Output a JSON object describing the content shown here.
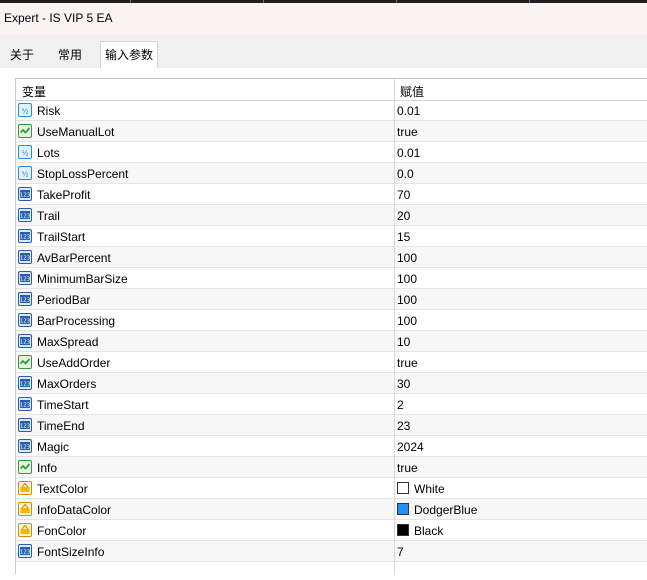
{
  "window": {
    "title": "Expert - IS VIP 5 EA"
  },
  "tabs": [
    {
      "label": "关于",
      "active": false
    },
    {
      "label": "常用",
      "active": false
    },
    {
      "label": "输入参数",
      "active": true
    }
  ],
  "table": {
    "headers": {
      "variable": "变量",
      "value": "赋值"
    },
    "rows": [
      {
        "name": "Risk",
        "value": "0.01",
        "type": "double"
      },
      {
        "name": "UseManualLot",
        "value": "true",
        "type": "bool"
      },
      {
        "name": "Lots",
        "value": "0.01",
        "type": "double"
      },
      {
        "name": "StopLossPercent",
        "value": "0.0",
        "type": "double"
      },
      {
        "name": "TakeProfit",
        "value": "70",
        "type": "int"
      },
      {
        "name": "Trail",
        "value": "20",
        "type": "int"
      },
      {
        "name": "TrailStart",
        "value": "15",
        "type": "int"
      },
      {
        "name": "AvBarPercent",
        "value": "100",
        "type": "int"
      },
      {
        "name": "MinimumBarSize",
        "value": "100",
        "type": "int"
      },
      {
        "name": "PeriodBar",
        "value": "100",
        "type": "int"
      },
      {
        "name": "BarProcessing",
        "value": "100",
        "type": "int"
      },
      {
        "name": "MaxSpread",
        "value": "10",
        "type": "int"
      },
      {
        "name": "UseAddOrder",
        "value": "true",
        "type": "bool"
      },
      {
        "name": "MaxOrders",
        "value": "30",
        "type": "int"
      },
      {
        "name": "TimeStart",
        "value": "2",
        "type": "int"
      },
      {
        "name": "TimeEnd",
        "value": "23",
        "type": "int"
      },
      {
        "name": "Magic",
        "value": "2024",
        "type": "int"
      },
      {
        "name": "Info",
        "value": "true",
        "type": "bool"
      },
      {
        "name": "TextColor",
        "value": "White",
        "type": "color",
        "swatch": "#ffffff"
      },
      {
        "name": "InfoDataColor",
        "value": "DodgerBlue",
        "type": "color",
        "swatch": "#1e90ff"
      },
      {
        "name": "FonColor",
        "value": "Black",
        "type": "color",
        "swatch": "#000000"
      },
      {
        "name": "FontSizeInfo",
        "value": "7",
        "type": "int"
      }
    ]
  }
}
